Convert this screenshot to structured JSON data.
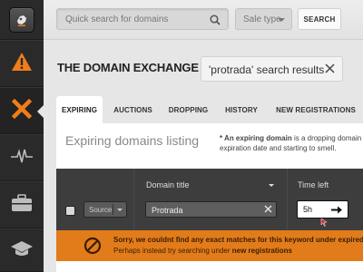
{
  "sidebar": {
    "items": [
      {
        "icon": "app-logo-icon"
      },
      {
        "icon": "warning-icon",
        "color": "#f07d1a"
      },
      {
        "icon": "x-close-icon",
        "color": "#f07d1a",
        "active": true
      },
      {
        "icon": "pulse-icon"
      },
      {
        "icon": "briefcase-icon"
      },
      {
        "icon": "graduation-cap-icon"
      }
    ]
  },
  "topbar": {
    "search_placeholder": "Quick search for domains",
    "sale_type": "Sale type",
    "search_button": "SEARCH"
  },
  "header": {
    "title": "THE DOMAIN EXCHANGE",
    "search_results": "'protrada' search results"
  },
  "tabs": [
    {
      "label": "EXPIRING",
      "active": true
    },
    {
      "label": "AUCTIONS"
    },
    {
      "label": "DROPPING"
    },
    {
      "label": "HISTORY"
    },
    {
      "label": "NEW REGISTRATIONS"
    }
  ],
  "listing": {
    "title": "Expiring domains listing",
    "note_bold": "* An expiring domain",
    "note_rest": " is a dropping domain th",
    "note_line2": "expiration date and starting to smell."
  },
  "table": {
    "source_label": "Source",
    "domain_title_label": "Domain title",
    "domain_filter_value": "Protrada",
    "time_left_label": "Time left",
    "time_left_value": "5h"
  },
  "notice": {
    "line1_pre": "Sorry, we couldnt find any exact matches for this keyword ",
    "line1_bold": "under expired d",
    "line2_pre": "Perhaps instead try searching under ",
    "line2_bold": "new registrations"
  },
  "colors": {
    "accent": "#f07d1a",
    "notice_bg": "#e27c1b",
    "sidebar_bg": "#2a2a2a"
  }
}
